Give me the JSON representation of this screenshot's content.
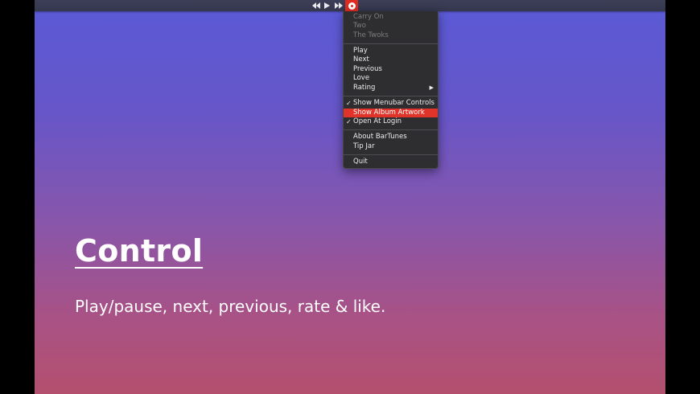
{
  "menubar": {
    "controls": {
      "previous_icon": "rewind-icon",
      "play_icon": "play-icon",
      "next_icon": "fast-forward-icon",
      "app_icon": "bartunes-app-icon"
    }
  },
  "menu": {
    "track_info": {
      "title": "Carry On",
      "album": "Two",
      "artist": "The Twoks"
    },
    "playback": {
      "play": "Play",
      "next": "Next",
      "previous": "Previous",
      "love": "Love",
      "rating": "Rating"
    },
    "options": {
      "show_menubar_controls": "Show Menubar Controls",
      "show_album_artwork": "Show Album Artwork",
      "open_at_login": "Open At Login",
      "check_mark": "✓"
    },
    "about": {
      "about": "About BarTunes",
      "tip_jar": "Tip Jar"
    },
    "quit": "Quit",
    "highlight_color": "#e0342a"
  },
  "promo": {
    "headline": "Control",
    "subline": "Play/pause, next, previous, rate & like."
  },
  "colors": {
    "gradient_top": "#5a5ad6",
    "gradient_bottom": "#b4506e",
    "accent": "#e02b22"
  }
}
